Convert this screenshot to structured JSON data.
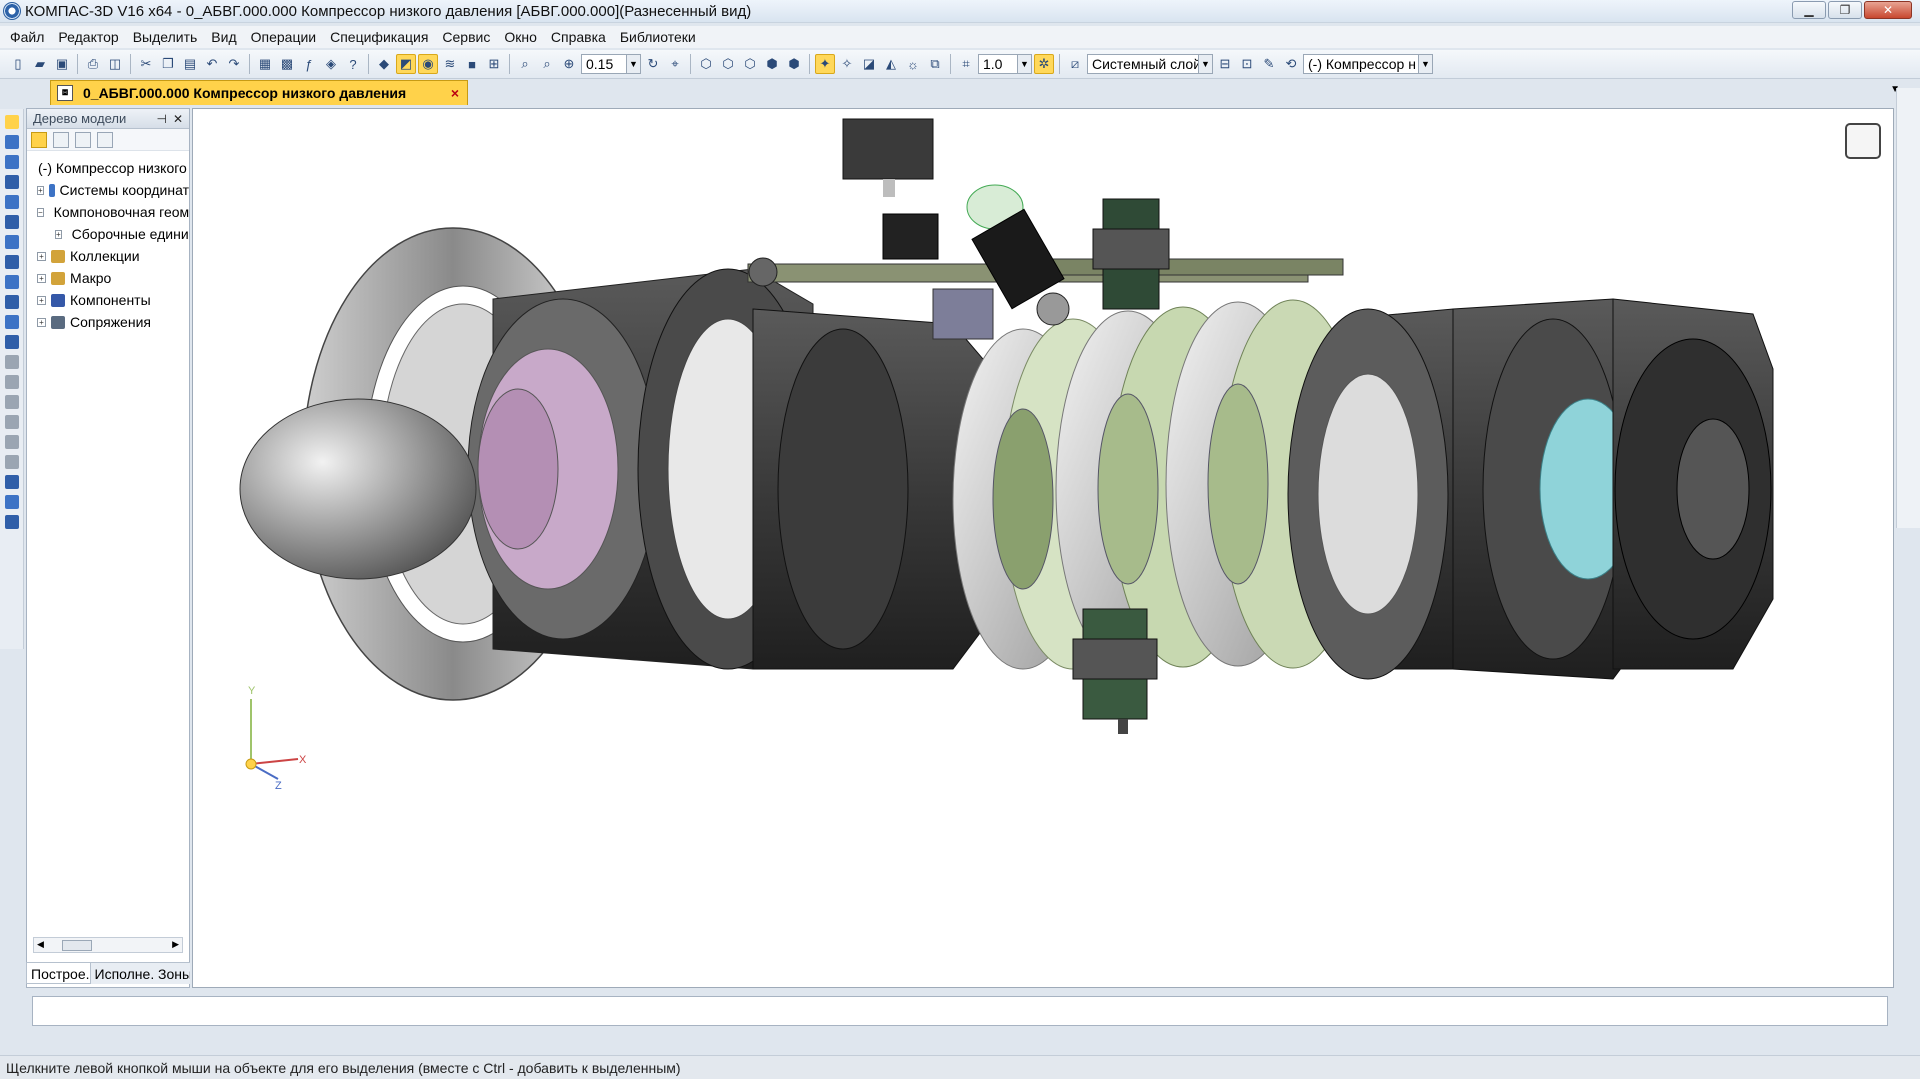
{
  "window": {
    "title": "КОМПАС-3D V16  x64 - 0_АБВГ.000.000 Компрессор низкого давления [АБВГ.000.000](Разнесенный вид)"
  },
  "menu": [
    "Файл",
    "Редактор",
    "Выделить",
    "Вид",
    "Операции",
    "Спецификация",
    "Сервис",
    "Окно",
    "Справка",
    "Библиотеки"
  ],
  "toolbar": {
    "zoom_value": "0.15",
    "step_value": "1.0",
    "layer": "Системный слой",
    "component": "(-) Компрессор н"
  },
  "document_tab": {
    "label": "0_АБВГ.000.000 Компрессор низкого давления",
    "close": "×"
  },
  "tree_panel": {
    "title": "Дерево модели",
    "nodes": [
      {
        "label": "(-) Компрессор низкого давления"
      },
      {
        "label": "Системы координат"
      },
      {
        "label": "Компоновочная геометрия"
      },
      {
        "label": "Сборочные единицы"
      },
      {
        "label": "Коллекции"
      },
      {
        "label": "Макро"
      },
      {
        "label": "Компоненты"
      },
      {
        "label": "Сопряжения"
      }
    ],
    "tabs": [
      "Построе...",
      "Исполне...",
      "Зоны"
    ]
  },
  "triad": {
    "x": "X",
    "y": "Y",
    "z": "Z"
  },
  "status": "Щелкните левой кнопкой мыши на объекте для его выделения (вместе с Ctrl - добавить к выделенным)"
}
